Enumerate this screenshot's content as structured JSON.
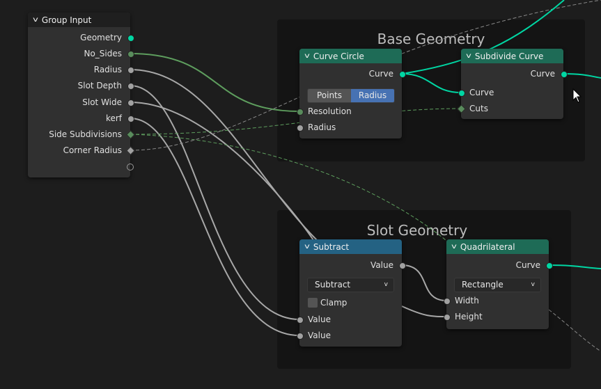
{
  "frames": {
    "base": "Base Geometry",
    "slot": "Slot Geometry"
  },
  "group_input": {
    "title": "Group Input",
    "outputs": [
      "Geometry",
      "No_Sides",
      "Radius",
      "Slot Depth",
      "Slot Wide",
      "kerf",
      "Side Subdivisions",
      "Corner Radius"
    ]
  },
  "curve_circle": {
    "title": "Curve Circle",
    "output": "Curve",
    "modes": [
      "Points",
      "Radius"
    ],
    "active_mode": "Radius",
    "inputs": [
      "Resolution",
      "Radius"
    ]
  },
  "subdivide_curve": {
    "title": "Subdivide Curve",
    "output": "Curve",
    "inputs": [
      "Curve",
      "Cuts"
    ]
  },
  "subtract": {
    "title": "Subtract",
    "output": "Value",
    "operation": "Subtract",
    "clamp_label": "Clamp",
    "clamp": false,
    "inputs": [
      "Value",
      "Value"
    ]
  },
  "quadrilateral": {
    "title": "Quadrilateral",
    "output": "Curve",
    "mode": "Rectangle",
    "inputs": [
      "Width",
      "Height"
    ]
  },
  "colors": {
    "geometry_header": "#1e6b56",
    "math_header": "#246283",
    "geometry_socket": "#00d6a3",
    "int_socket": "#598c5c",
    "float_socket": "#a1a1a1"
  }
}
